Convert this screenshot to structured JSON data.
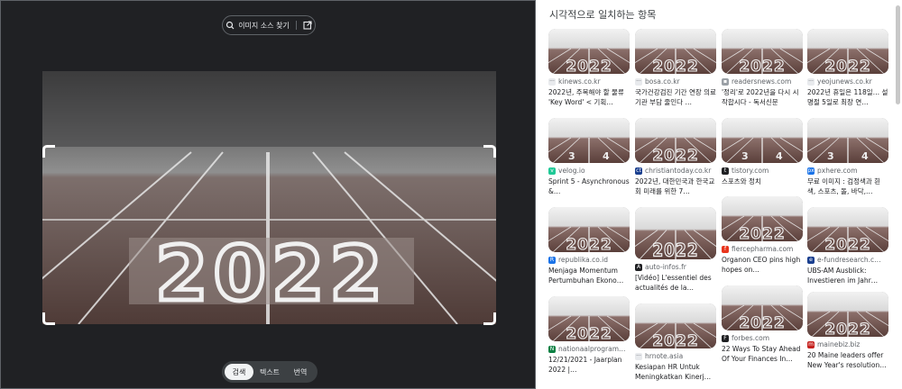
{
  "lens": {
    "find_source_label": "이미지 소스 찾기",
    "tabs": [
      {
        "label": "검색",
        "active": true
      },
      {
        "label": "텍스트",
        "active": false
      },
      {
        "label": "번역",
        "active": false
      }
    ],
    "image_text": "2022"
  },
  "results": {
    "title": "시각적으로 일치하는 항목",
    "columns": [
      [
        {
          "site": "kinews.co.kr",
          "fav_color": "#e8eaed",
          "fav_char": "···",
          "title": "2022년, 주목해야 할 물류 'Key Word' < 기획…",
          "variant": "2022"
        },
        {
          "site": "velog.io",
          "fav_color": "#20c997",
          "fav_char": "v",
          "title": "Sprint 5 - Asynchronous &…",
          "variant": "lanes"
        },
        {
          "site": "republika.co.id",
          "fav_color": "#1a73e8",
          "fav_char": "R",
          "title": "Menjaga Momentum Pertumbuhan Ekono…",
          "variant": "2022"
        },
        {
          "site": "nationaalprogram…",
          "fav_color": "#0b8043",
          "fav_char": "N",
          "title": "12/21/2021 - Jaarplan 2022 |…",
          "variant": "2022"
        }
      ],
      [
        {
          "site": "bosa.co.kr",
          "fav_color": "#e8eaed",
          "fav_char": "···",
          "title": "국가건강검진 기간 연장 의료기관 부담 줄인다 …",
          "variant": "2022"
        },
        {
          "site": "christiantoday.co.kr",
          "fav_color": "#1a3f8f",
          "fav_char": "ct",
          "title": "2022년, 대한민국과 한국교회 미래를 위한 7…",
          "variant": "2022"
        },
        {
          "site": "auto-infos.fr",
          "fav_color": "#202124",
          "fav_char": "A",
          "title": "[Vidéo] L'essentiel des actualités de la…",
          "variant": "2022"
        },
        {
          "site": "hrnote.asia",
          "fav_color": "#e8eaed",
          "fav_char": "···",
          "title": "Kesiapan HR Untuk Meningkatkan Kinerj…",
          "variant": "2022"
        }
      ],
      [
        {
          "site": "readersnews.com",
          "fav_color": "#9aa0a6",
          "fav_char": "▪",
          "title": "'정리'로 2022년을 다시 시작합시다 - 독서신문",
          "variant": "2022"
        },
        {
          "site": "tistory.com",
          "fav_color": "#202124",
          "fav_char": "t",
          "title": "스포츠와 정치",
          "variant": "lanes"
        },
        {
          "site": "fiercepharma.com",
          "fav_color": "#e8341c",
          "fav_char": "f",
          "title": "Organon CEO pins high hopes on…",
          "variant": "2022"
        },
        {
          "site": "forbes.com",
          "fav_color": "#202124",
          "fav_char": "F",
          "title": "22 Ways To Stay Ahead Of Your Finances In…",
          "variant": "2022"
        }
      ],
      [
        {
          "site": "yeojunews.co.kr",
          "fav_color": "#e8eaed",
          "fav_char": "···",
          "title": "2022년 휴일은 118일… 설명절 5일로 최장 연…",
          "variant": "2022"
        },
        {
          "site": "pxhere.com",
          "fav_color": "#1a73e8",
          "fav_char": "px",
          "title": "무료 이미지 : 검정색과 흰색, 스포츠, 돌, 바닥,…",
          "variant": "lanes"
        },
        {
          "site": "e-fundresearch.c…",
          "fav_color": "#1a3f8f",
          "fav_char": "e",
          "title": "UBS-AM Ausblick: Investieren im Jahr…",
          "variant": "2022"
        },
        {
          "site": "mainebiz.biz",
          "fav_color": "#c5221f",
          "fav_char": "m",
          "title": "20 Maine leaders offer New Year's resolution…",
          "variant": "2022"
        }
      ]
    ]
  }
}
